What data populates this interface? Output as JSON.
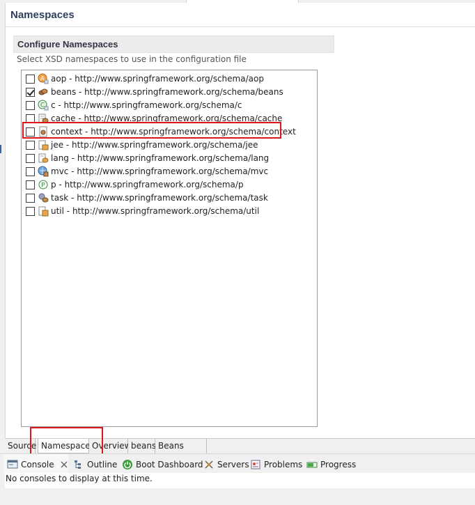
{
  "editor": {
    "title": "Namespaces",
    "section_title": "Configure Namespaces",
    "section_desc": "Select XSD namespaces to use in the configuration file"
  },
  "namespaces": [
    {
      "label": "aop - http://www.springframework.org/schema/aop",
      "checked": false,
      "icon": "aop-icon"
    },
    {
      "label": "beans - http://www.springframework.org/schema/beans",
      "checked": true,
      "icon": "beans-icon"
    },
    {
      "label": "c - http://www.springframework.org/schema/c",
      "checked": false,
      "icon": "c-namespace-icon"
    },
    {
      "label": "cache - http://www.springframework.org/schema/cache",
      "checked": false,
      "icon": "cache-icon"
    },
    {
      "label": "context - http://www.springframework.org/schema/context",
      "checked": false,
      "icon": "context-icon"
    },
    {
      "label": "jee - http://www.springframework.org/schema/jee",
      "checked": false,
      "icon": "jee-icon"
    },
    {
      "label": "lang - http://www.springframework.org/schema/lang",
      "checked": false,
      "icon": "lang-icon"
    },
    {
      "label": "mvc - http://www.springframework.org/schema/mvc",
      "checked": false,
      "icon": "mvc-icon"
    },
    {
      "label": "p - http://www.springframework.org/schema/p",
      "checked": false,
      "icon": "p-namespace-icon"
    },
    {
      "label": "task - http://www.springframework.org/schema/task",
      "checked": false,
      "icon": "task-icon"
    },
    {
      "label": "util - http://www.springframework.org/schema/util",
      "checked": false,
      "icon": "util-icon"
    }
  ],
  "editor_tabs": [
    "Source",
    "Namespaces",
    "Overview",
    "beans",
    "Beans Graph"
  ],
  "active_editor_tab": "Namespaces",
  "views": {
    "console": "Console",
    "outline": "Outline",
    "boot_dashboard": "Boot Dashboard",
    "servers": "Servers",
    "problems": "Problems",
    "progress": "Progress"
  },
  "console_message": "No consoles to display at this time.",
  "colors": {
    "highlight": "#e0141b",
    "title": "#2f3f5a"
  }
}
